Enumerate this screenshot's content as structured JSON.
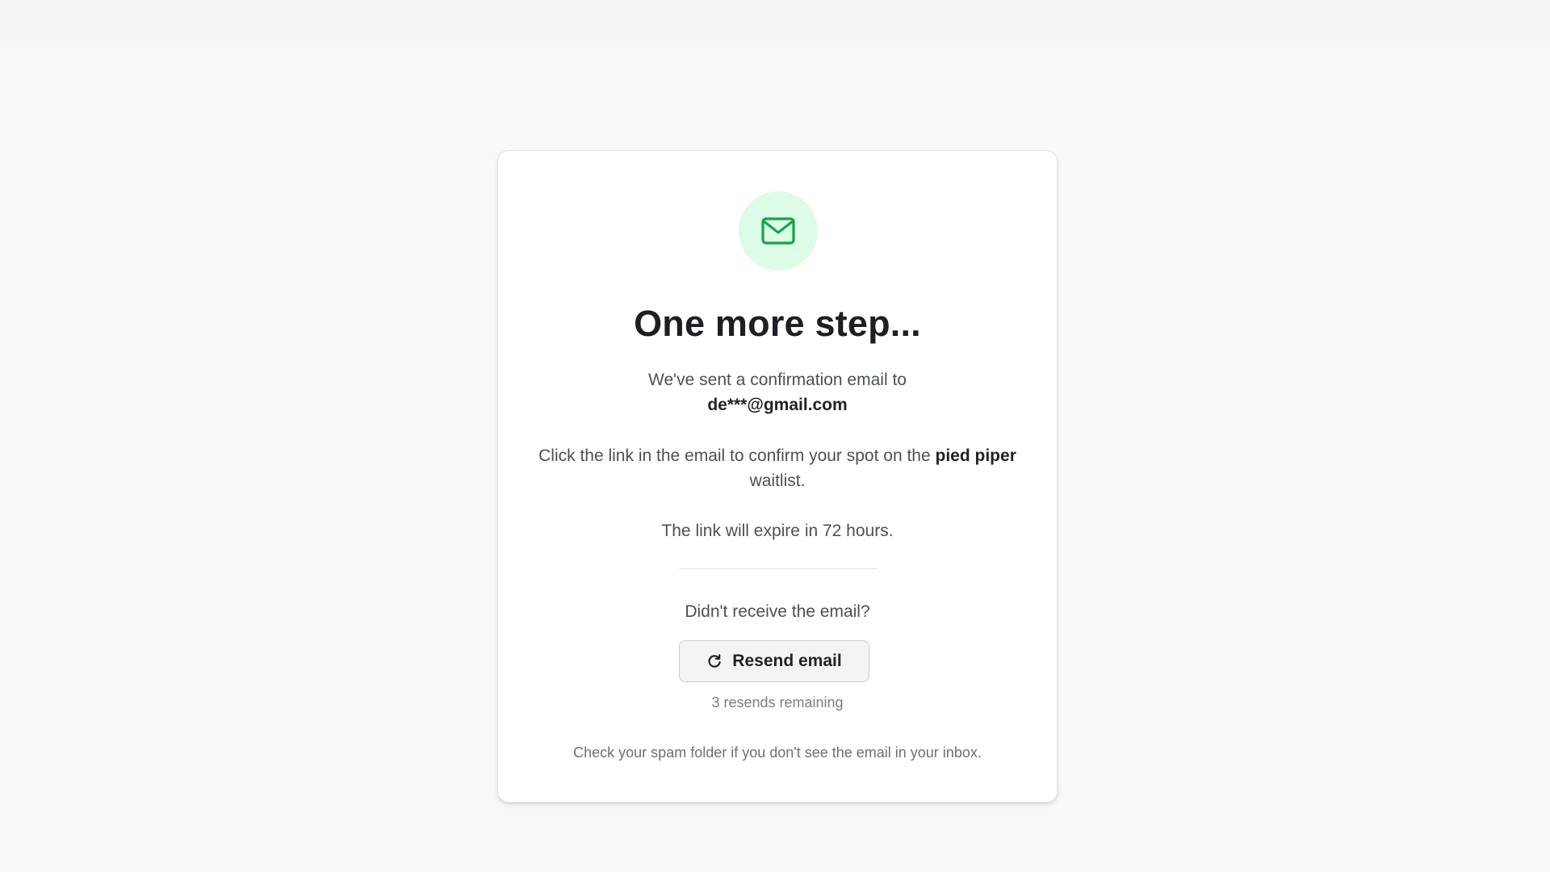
{
  "card": {
    "title": "One more step...",
    "sent_prefix": "We've sent a confirmation email to",
    "email": "de***@gmail.com",
    "click_prefix": "Click the link in the email to confirm your spot on the",
    "product_name": "pied piper",
    "click_suffix": "waitlist.",
    "expire_text": "The link will expire in 72 hours.",
    "didnt_receive": "Didn't receive the email?",
    "resend_label": "Resend email",
    "resends_remaining": "3 resends remaining",
    "spam_hint": "Check your spam folder if you don't see the email in your inbox."
  },
  "icons": {
    "mail": "mail-icon",
    "refresh": "refresh-icon"
  },
  "colors": {
    "accent_green": "#16a34a",
    "icon_circle_bg": "#dcfce7"
  }
}
